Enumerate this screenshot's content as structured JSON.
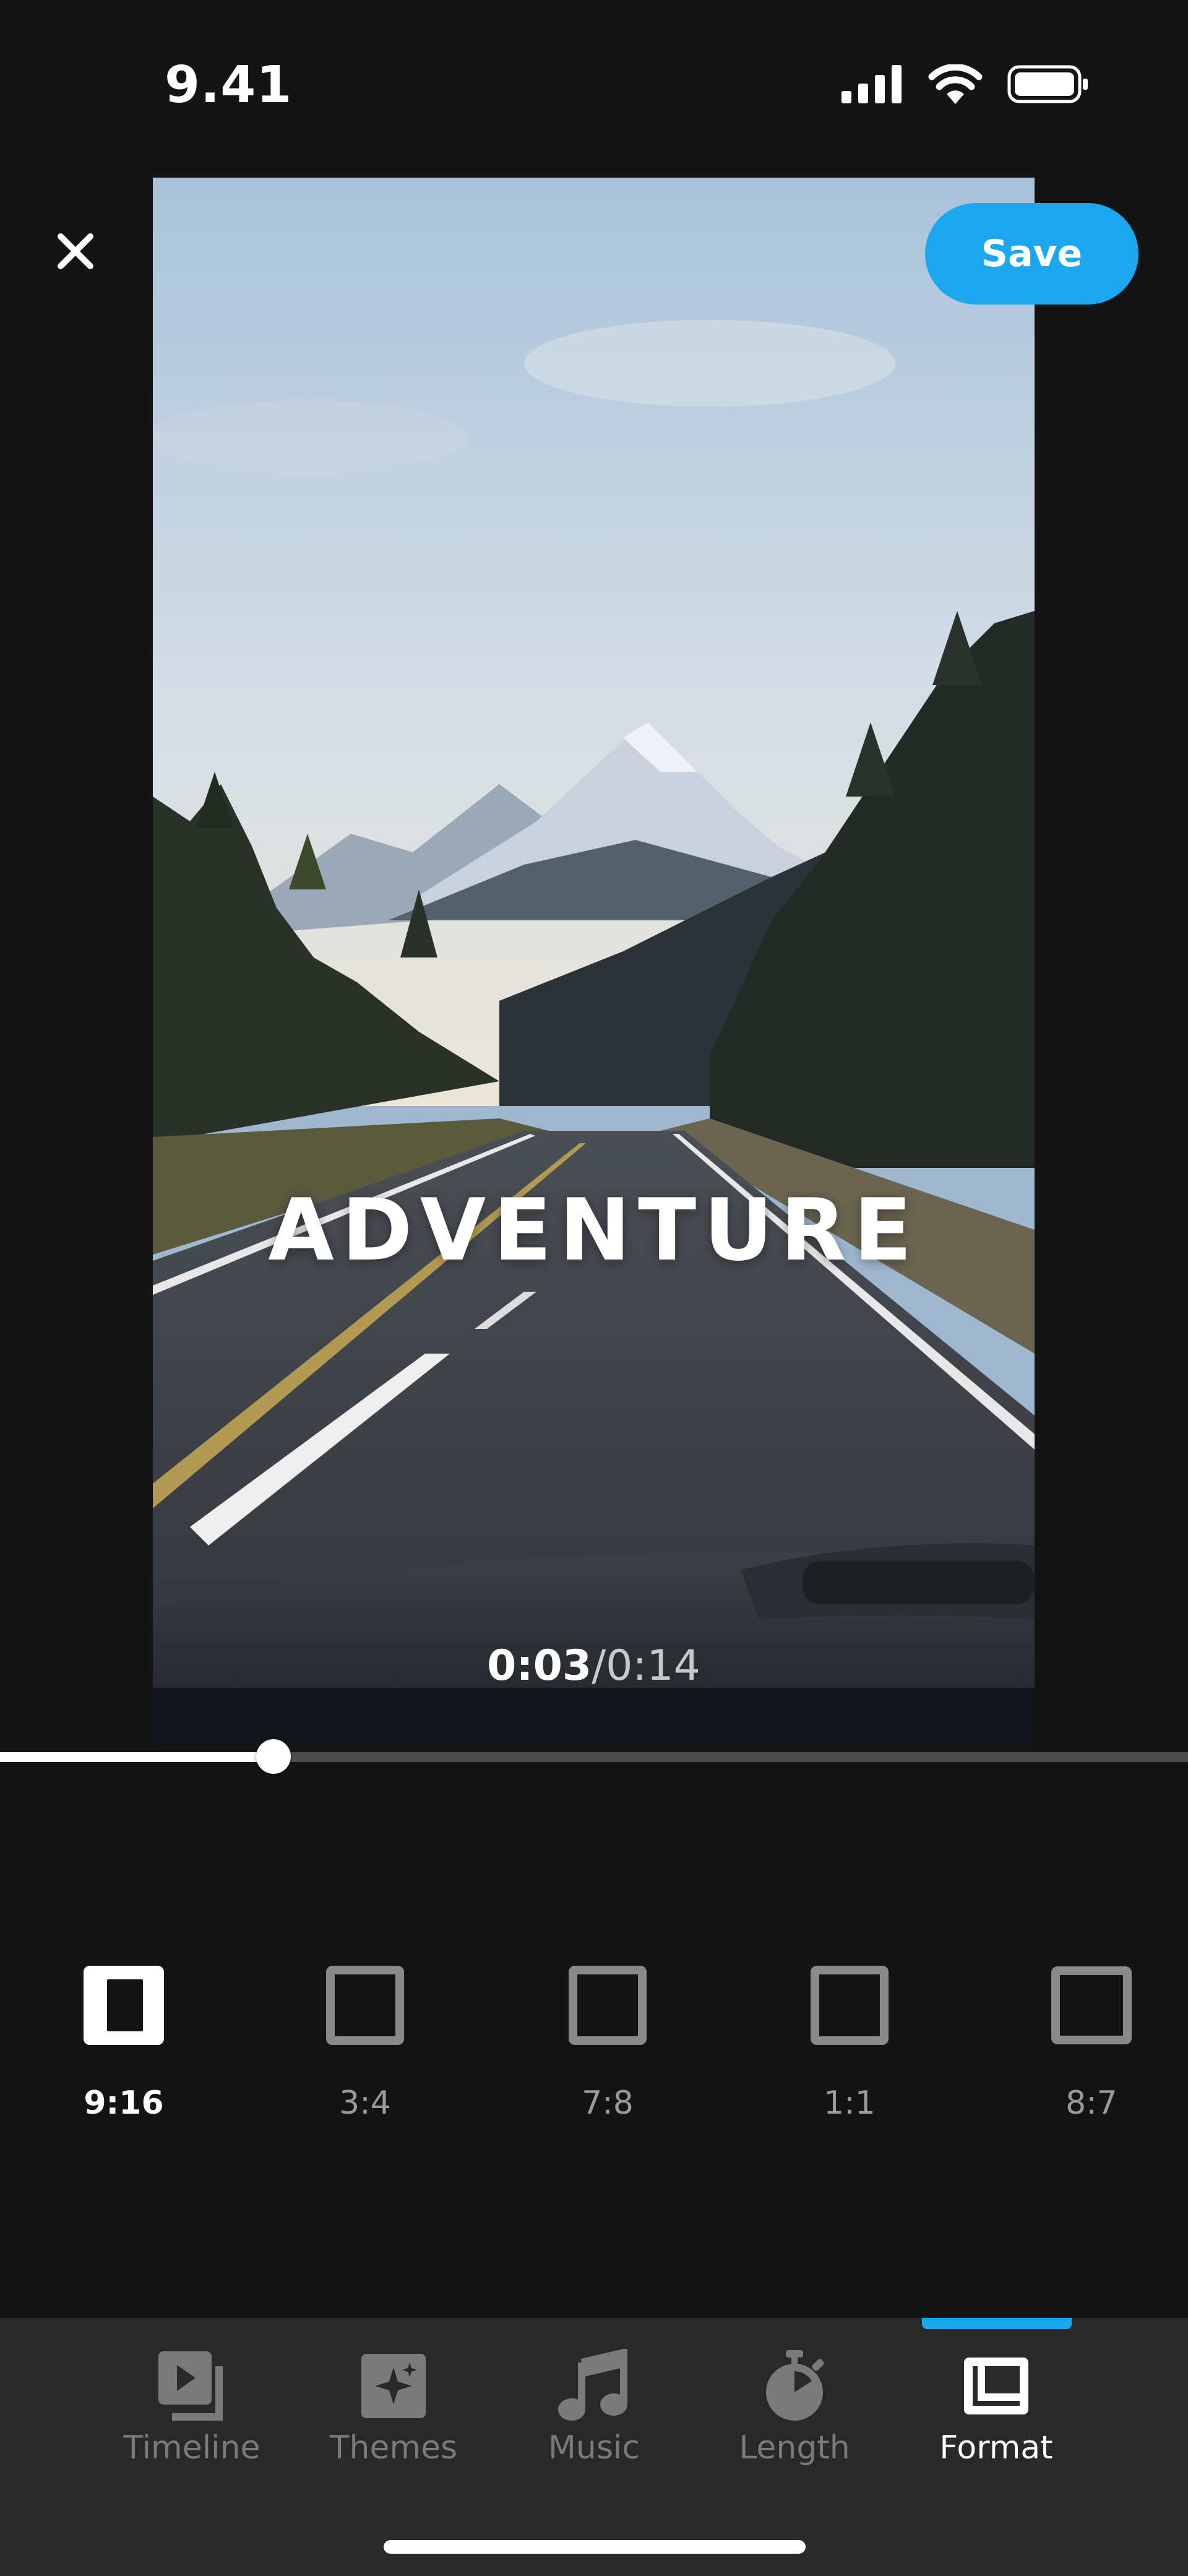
{
  "status_bar": {
    "time": "9.41"
  },
  "header": {
    "save_label": "Save"
  },
  "preview": {
    "overlay_title": "ADVENTURE",
    "current_time": "0:03",
    "separator": "/",
    "total_time": "0:14"
  },
  "scrubber": {
    "progress": 0.23
  },
  "formats": {
    "selected": "9:16",
    "options": [
      {
        "label": "9:16"
      },
      {
        "label": "3:4"
      },
      {
        "label": "7:8"
      },
      {
        "label": "1:1"
      },
      {
        "label": "8:7"
      }
    ]
  },
  "tabs": [
    {
      "label": "Timeline",
      "icon": "timeline-icon"
    },
    {
      "label": "Themes",
      "icon": "themes-icon"
    },
    {
      "label": "Music",
      "icon": "music-icon"
    },
    {
      "label": "Length",
      "icon": "length-icon"
    },
    {
      "label": "Format",
      "icon": "format-icon",
      "active": true
    }
  ],
  "colors": {
    "accent": "#1aa7f0",
    "background": "#141414",
    "tabbar": "#292929",
    "inactive_text": "#7a7a7a"
  }
}
